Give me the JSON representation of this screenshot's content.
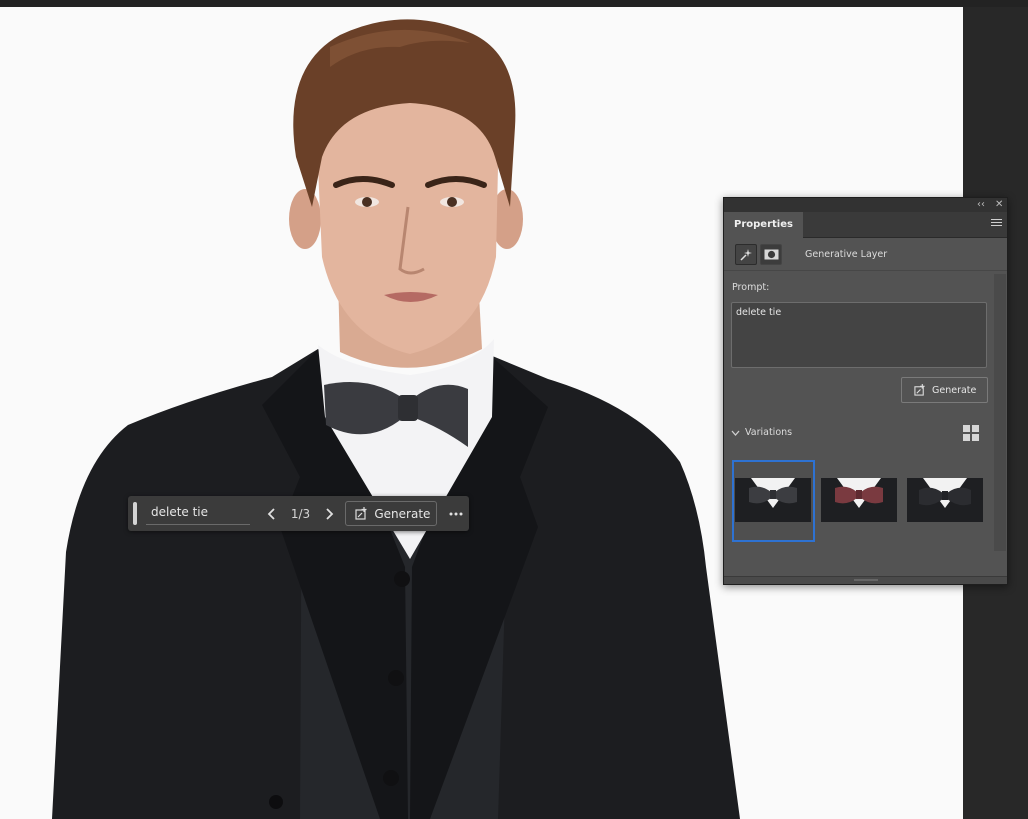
{
  "taskbar": {
    "prompt_value": "delete tie",
    "counter": "1/3",
    "generate_label": "Generate"
  },
  "panel": {
    "tab_label": "Properties",
    "layer_label": "Generative Layer",
    "prompt_label": "Prompt:",
    "prompt_value": "delete tie",
    "generate_label": "Generate",
    "variations_label": "Variations",
    "selected_variation": 1
  },
  "colors": {
    "accent": "#2e72d2",
    "panel_bg": "#535353",
    "canvas_bg": "#fafafa"
  },
  "icons": {
    "window_collapse": "double-chevron-left-icon",
    "window_close": "close-icon",
    "panel_menu": "hamburger-menu-icon",
    "layer_type": "generative-sparkle-icon",
    "layer_mask": "mask-icon",
    "generate": "generate-icon",
    "prev": "chevron-left-icon",
    "next": "chevron-right-icon",
    "more": "more-horizontal-icon",
    "expand": "chevron-down-icon",
    "grid_view": "grid-view-icon"
  }
}
